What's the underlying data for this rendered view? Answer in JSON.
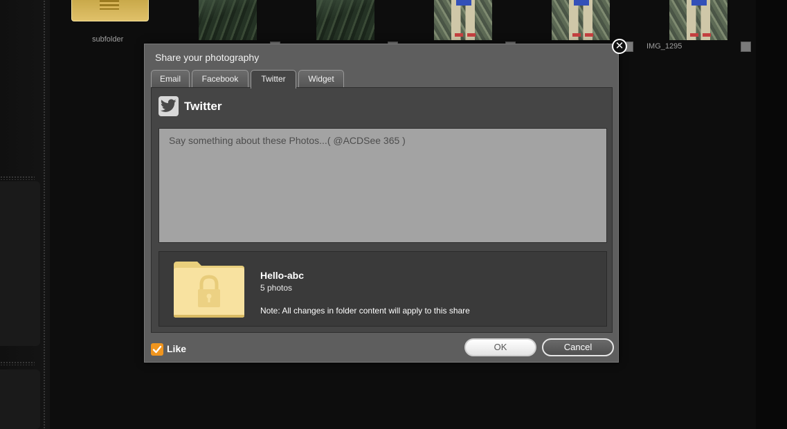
{
  "background": {
    "folder_label": "subfolder",
    "image_label": "IMG_1295"
  },
  "dialog": {
    "title": "Share your photography",
    "close_symbol": "✕",
    "tabs": [
      {
        "label": "Email"
      },
      {
        "label": "Facebook"
      },
      {
        "label": "Twitter",
        "active": true
      },
      {
        "label": "Widget"
      }
    ],
    "twitter": {
      "heading": "Twitter",
      "icon": "twitter-bird-icon",
      "message_placeholder": "Say something about these Photos...( @ACDSee 365 )",
      "message_value": ""
    },
    "share": {
      "name": "Hello-abc",
      "count": "5 photos",
      "note": "Note: All changes in folder content will apply to this share",
      "icon": "locked-folder-icon"
    },
    "footer": {
      "like_label": "Like",
      "like_checked": true,
      "ok_label": "OK",
      "cancel_label": "Cancel"
    }
  },
  "colors": {
    "accent_orange": "#f0951e",
    "dialog_bg": "#5e5e5e",
    "panel_bg": "#454545"
  }
}
